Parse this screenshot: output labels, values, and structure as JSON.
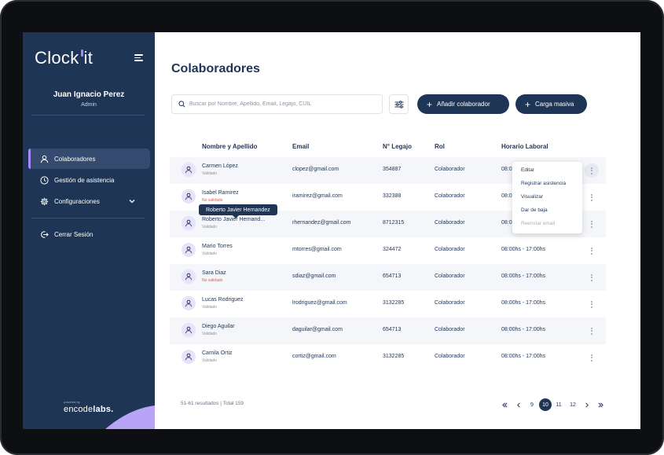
{
  "app": {
    "logo_text_1": "Clock",
    "logo_text_2": "it"
  },
  "user": {
    "name": "Juan Ignacio Perez",
    "role": "Admin"
  },
  "sidebar": {
    "items": [
      {
        "label": "Colaboradores",
        "icon": "user-icon",
        "active": true
      },
      {
        "label": "Gestión de asistencia",
        "icon": "clock-icon",
        "active": false
      },
      {
        "label": "Configuraciones",
        "icon": "gear-icon",
        "active": false
      }
    ],
    "logout": "Cerrar Sesión",
    "powered_by": "powered by",
    "brand_1": "encode",
    "brand_2": "labs."
  },
  "main": {
    "title": "Colaboradores",
    "search_placeholder": "Buscar por Nombre, Apellido, Email, Legajo, CUIL",
    "add_button": "Añadir colaborador",
    "bulk_button": "Carga masiva"
  },
  "table": {
    "headers": [
      "Nombre y Apellido",
      "Email",
      "N° Legajo",
      "Rol",
      "Horario Laboral"
    ],
    "rows": [
      {
        "name": "Carmen López",
        "status": "Validado",
        "email": "clopez@gmail.com",
        "legajo": "354887",
        "rol": "Colaborador",
        "horario": "08:0",
        "validated": true
      },
      {
        "name": "Isabel Ramirez",
        "status": "No validado",
        "email": "iramirez@gmail.com",
        "legajo": "332388",
        "rol": "Colaborador",
        "horario": "08:0",
        "validated": false
      },
      {
        "name": "Roberto Javier Hernand...",
        "status": "Validado",
        "email": "rhernandez@gmail.com",
        "legajo": "8712315",
        "rol": "Colaborador",
        "horario": "08:0",
        "validated": true
      },
      {
        "name": "Mario Torres",
        "status": "Validado",
        "email": "mtorres@gmail.com",
        "legajo": "324472",
        "rol": "Colaborador",
        "horario": "08:00hs - 17:00hs",
        "validated": true
      },
      {
        "name": "Sara Diaz",
        "status": "No validado",
        "email": "sdiaz@gmail.com",
        "legajo": "654713",
        "rol": "Colaborador",
        "horario": "08:00hs - 17:00hs",
        "validated": false
      },
      {
        "name": "Lucas Rodriguez",
        "status": "Validado",
        "email": "lrodriguez@gmail.com",
        "legajo": "3132285",
        "rol": "Colaborador",
        "horario": "08:00hs - 17:00hs",
        "validated": true
      },
      {
        "name": "Diego Aguilar",
        "status": "Validado",
        "email": "daguilar@gmail.com",
        "legajo": "654713",
        "rol": "Colaborador",
        "horario": "08:00hs - 17:00hs",
        "validated": true
      },
      {
        "name": "Camila Ortiz",
        "status": "Validado",
        "email": "cortiz@gmail.com",
        "legajo": "3132285",
        "rol": "Colaborador",
        "horario": "08:00hs - 17:00hs",
        "validated": true
      }
    ]
  },
  "tooltip": "Roberto Javier Hernandez",
  "row_menu": {
    "options": [
      "Editar",
      "Registrar asistencia",
      "Visualizar",
      "Dar de baja"
    ],
    "disabled_option": "Reenviar email"
  },
  "footer": {
    "results": "51-61 resultados | Total 159",
    "pages": [
      "9",
      "10",
      "11",
      "12"
    ],
    "current_page": "10"
  },
  "colors": {
    "primary": "#1f3556",
    "accent": "#a78bfa",
    "invalid": "#e25b4b",
    "row_shade": "#f4f6f9"
  }
}
